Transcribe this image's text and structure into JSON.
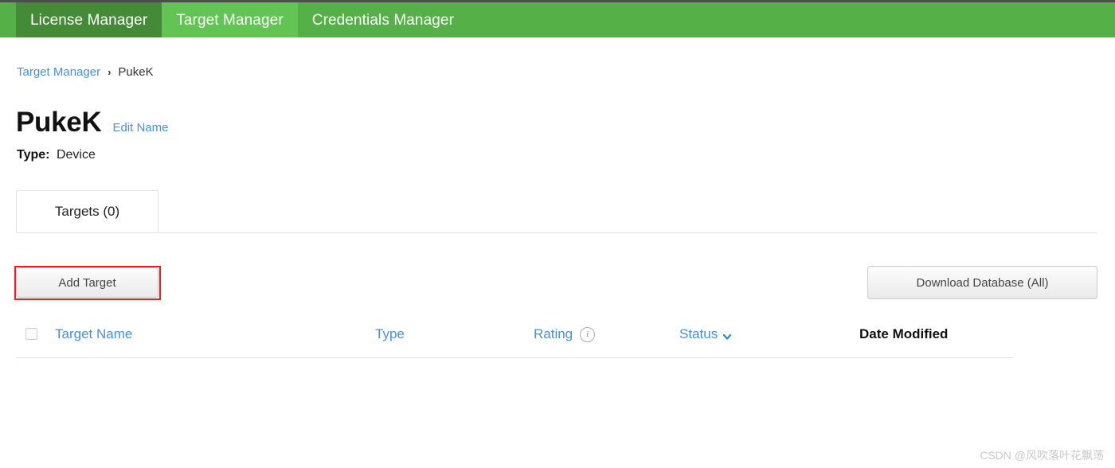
{
  "navbar": {
    "tabs": [
      {
        "label": "License Manager",
        "state": "inactive"
      },
      {
        "label": "Target Manager",
        "state": "active"
      },
      {
        "label": "Credentials Manager",
        "state": "plain"
      }
    ],
    "colors": {
      "bar": "#55b147",
      "active_tab": "#62c452",
      "inactive_tab": "#458b37",
      "top_strip": "#4a4f4b"
    }
  },
  "breadcrumb": {
    "root": "Target Manager",
    "separator": "›",
    "current": "PukeK"
  },
  "header": {
    "title": "PukeK",
    "edit_name_label": "Edit Name",
    "type_label": "Type:",
    "type_value": "Device"
  },
  "tabs": {
    "targets": "Targets (0)"
  },
  "actions": {
    "add_target_label": "Add Target",
    "download_database_label": "Download Database (All)",
    "highlight_color": "#ee1c25"
  },
  "table": {
    "columns": [
      {
        "label": "Target Name",
        "link": true
      },
      {
        "label": "Type",
        "link": true
      },
      {
        "label": "Rating",
        "link": true,
        "icon": "info-icon"
      },
      {
        "label": "Status",
        "link": true,
        "icon": "chevron-down-icon"
      },
      {
        "label": "Date Modified",
        "link": false
      }
    ],
    "info_glyph": "i",
    "rows": [],
    "link_color": "#4a90d9"
  },
  "watermark": {
    "text": "CSDN @风吹落叶花飘荡"
  }
}
